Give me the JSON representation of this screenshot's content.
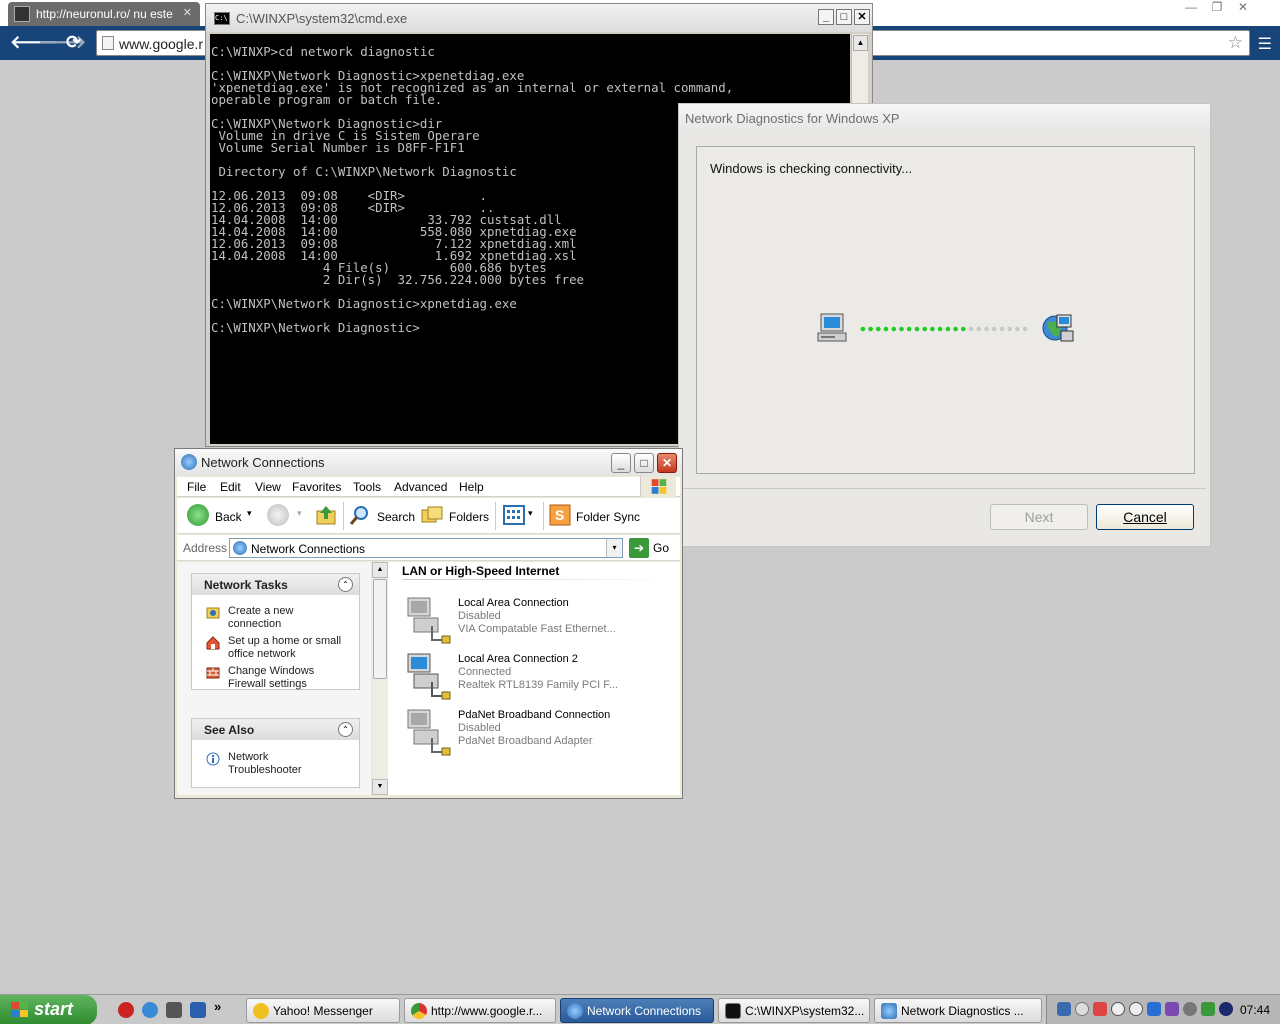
{
  "chrome": {
    "tab_title": "http://neuronul.ro/ nu este c",
    "tab_close": "✕",
    "omnibox_url": "www.google.r",
    "nav_back": "🡐",
    "nav_forward": "🡒",
    "nav_reload": "⟳",
    "star": "☆",
    "menu": "☰",
    "win_min": "—",
    "win_max": "❐",
    "win_close": "✕"
  },
  "cmd": {
    "title": "C:\\WINXP\\system32\\cmd.exe",
    "icon_text": "C:\\",
    "ctl_min": "_",
    "ctl_max": "□",
    "ctl_close": "✕",
    "output": "C:\\WINXP>cd network diagnostic\n\nC:\\WINXP\\Network Diagnostic>xpenetdiag.exe\n'xpenetdiag.exe' is not recognized as an internal or external command,\noperable program or batch file.\n\nC:\\WINXP\\Network Diagnostic>dir\n Volume in drive C is Sistem Operare\n Volume Serial Number is D8FF-F1F1\n\n Directory of C:\\WINXP\\Network Diagnostic\n\n12.06.2013  09:08    <DIR>          .\n12.06.2013  09:08    <DIR>          ..\n14.04.2008  14:00            33.792 custsat.dll\n14.04.2008  14:00           558.080 xpnetdiag.exe\n12.06.2013  09:08             7.122 xpnetdiag.xml\n14.04.2008  14:00             1.692 xpnetdiag.xsl\n               4 File(s)        600.686 bytes\n               2 Dir(s)  32.756.224.000 bytes free\n\nC:\\WINXP\\Network Diagnostic>xpnetdiag.exe\n\nC:\\WINXP\\Network Diagnostic>"
  },
  "diag": {
    "title": "Network Diagnostics for Windows XP",
    "status": "Windows is checking connectivity...",
    "progress_dots_filled": 14,
    "progress_dots_total": 22,
    "next_label": "Next",
    "cancel_label": "Cancel"
  },
  "netconn": {
    "title": "Network Connections",
    "ctl_min": "_",
    "ctl_max": "□",
    "ctl_close": "✕",
    "menu": [
      "File",
      "Edit",
      "View",
      "Favorites",
      "Tools",
      "Advanced",
      "Help"
    ],
    "toolbar": {
      "back": "Back",
      "search": "Search",
      "folders": "Folders",
      "folder_sync": "Folder Sync",
      "dropdown": "▾"
    },
    "address": {
      "label": "Address",
      "value": "Network Connections",
      "go": "Go",
      "dropdown": "▾"
    },
    "tasks": {
      "network_tasks_title": "Network Tasks",
      "items": [
        {
          "line1": "Create a new",
          "line2": "connection"
        },
        {
          "line1": "Set up a home or small",
          "line2": "office network"
        },
        {
          "line1": "Change Windows",
          "line2": "Firewall settings"
        }
      ],
      "see_also_title": "See Also",
      "see_also_items": [
        {
          "line1": "Network",
          "line2": "Troubleshooter"
        }
      ],
      "collapse_glyph": "⌃"
    },
    "group_header": "LAN or High-Speed Internet",
    "connections": [
      {
        "name": "Local Area Connection",
        "status": "Disabled",
        "device": "VIA Compatable Fast Ethernet..."
      },
      {
        "name": "Local Area Connection 2",
        "status": "Connected",
        "device": "Realtek RTL8139 Family PCI F..."
      },
      {
        "name": "PdaNet Broadband Connection",
        "status": "Disabled",
        "device": "PdaNet Broadband Adapter"
      }
    ],
    "scroll_up": "▲",
    "scroll_down": "▼"
  },
  "taskbar": {
    "start_label": "start",
    "buttons": [
      {
        "label": "Yahoo! Messenger",
        "color": "#f0c020"
      },
      {
        "label": "http://www.google.r...",
        "color": "#d33"
      },
      {
        "label": "Network Connections",
        "color": "#3a7fd0"
      },
      {
        "label": "C:\\WINXP\\system32...",
        "color": "#111"
      },
      {
        "label": "Network Diagnostics ...",
        "color": "#3a7fd0"
      }
    ],
    "quicklaunch_more": "»",
    "clock": "07:44"
  },
  "colors": {
    "xp_blue": "#2a6fb5",
    "progress_green": "#22cc22",
    "progress_gray": "#c8c8c8"
  }
}
